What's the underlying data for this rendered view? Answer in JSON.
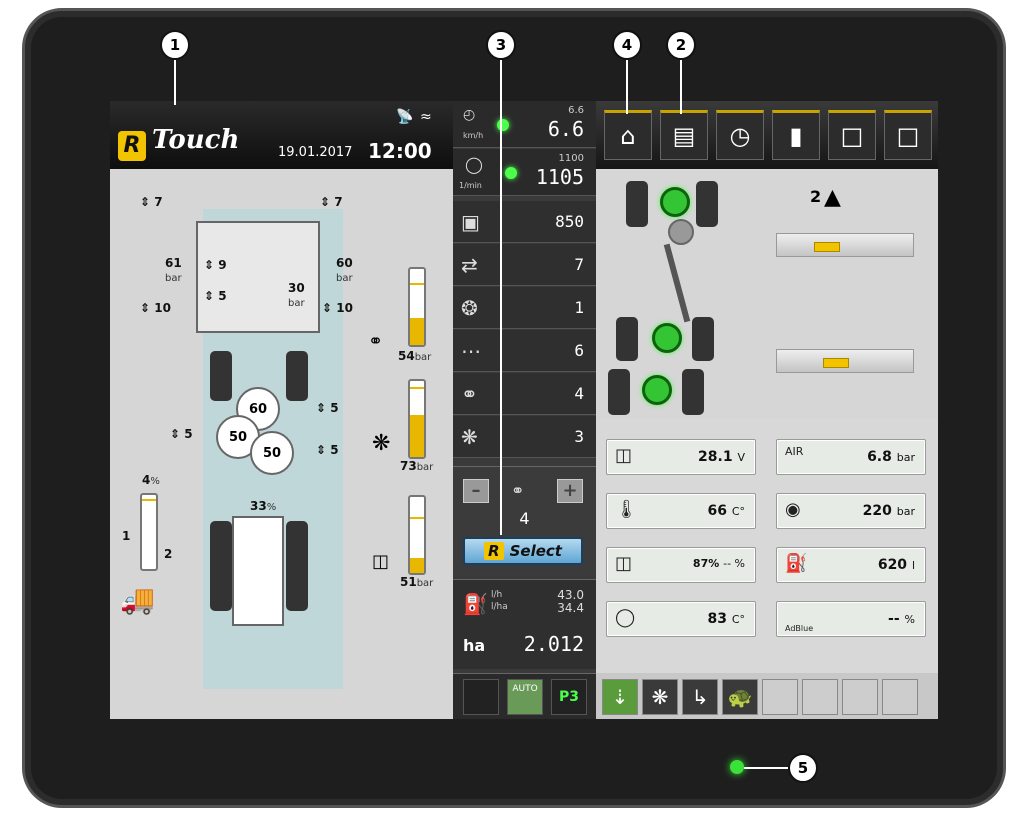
{
  "callouts": [
    "1",
    "2",
    "3",
    "4",
    "5"
  ],
  "header": {
    "brand": "Touch",
    "logo_letter": "R",
    "date": "19.01.2017",
    "time": "12:00"
  },
  "left": {
    "top_l": "7",
    "top_r": "7",
    "p_l": "61",
    "p_l_u": "bar",
    "p_r": "60",
    "p_r_u": "bar",
    "v9": "9",
    "v5": "5",
    "v30": "30",
    "v30_u": "bar",
    "v10_l": "10",
    "v10_r": "10",
    "c60": "60",
    "c50a": "50",
    "c50b": "50",
    "s5a": "5",
    "s5b": "5",
    "s5c": "5",
    "pct4": "4",
    "pct4_u": "%",
    "pct33": "33",
    "pct33_u": "%",
    "scale1": "1",
    "scale2": "2",
    "g1": "54",
    "g2": "73",
    "g3": "51",
    "g_u": "bar",
    "gauge_levels": [
      0.35,
      0.55,
      0.2
    ]
  },
  "middle": {
    "speed_small": "6.6",
    "speed": "6.6",
    "speed_unit": "km/h",
    "rpm_small": "1100",
    "rpm": "1105",
    "rpm_unit": "1/min",
    "rows": [
      "850",
      "7",
      "1",
      "6",
      "4",
      "3"
    ],
    "select_value": "4",
    "minus": "–",
    "plus": "+",
    "select_label": "Select",
    "select_logo": "R",
    "fuel_lh_u": "l/h",
    "fuel_lh": "43.0",
    "fuel_lha_u": "l/ha",
    "fuel_lha": "34.4",
    "ha_label": "ha",
    "ha": "2.012",
    "auto": "AUTO",
    "p3": "P3"
  },
  "right": {
    "axle_num": "2",
    "values": [
      {
        "icon": "battery-icon",
        "num": "28.1",
        "unit": "V"
      },
      {
        "icon": "air-icon",
        "num": "6.8",
        "unit": "bar",
        "label": "AIR"
      },
      {
        "icon": "oil-temp-icon",
        "num": "66",
        "unit": "C°"
      },
      {
        "icon": "brake-pressure-icon",
        "num": "220",
        "unit": "bar"
      },
      {
        "icon": "hydraulic-oil-icon",
        "num": "87%",
        "unit": "-- %"
      },
      {
        "icon": "fuel-icon",
        "num": "620",
        "unit": "l"
      },
      {
        "icon": "coolant-temp-icon",
        "num": "83",
        "unit": "C°"
      },
      {
        "icon": "adblue-icon",
        "num": "--",
        "unit": "%",
        "label": "AdBlue"
      }
    ],
    "slider_levels": [
      0.34,
      0.42
    ]
  },
  "colors": {
    "brand_yellow": "#f2c400",
    "led_green": "#39e139"
  }
}
